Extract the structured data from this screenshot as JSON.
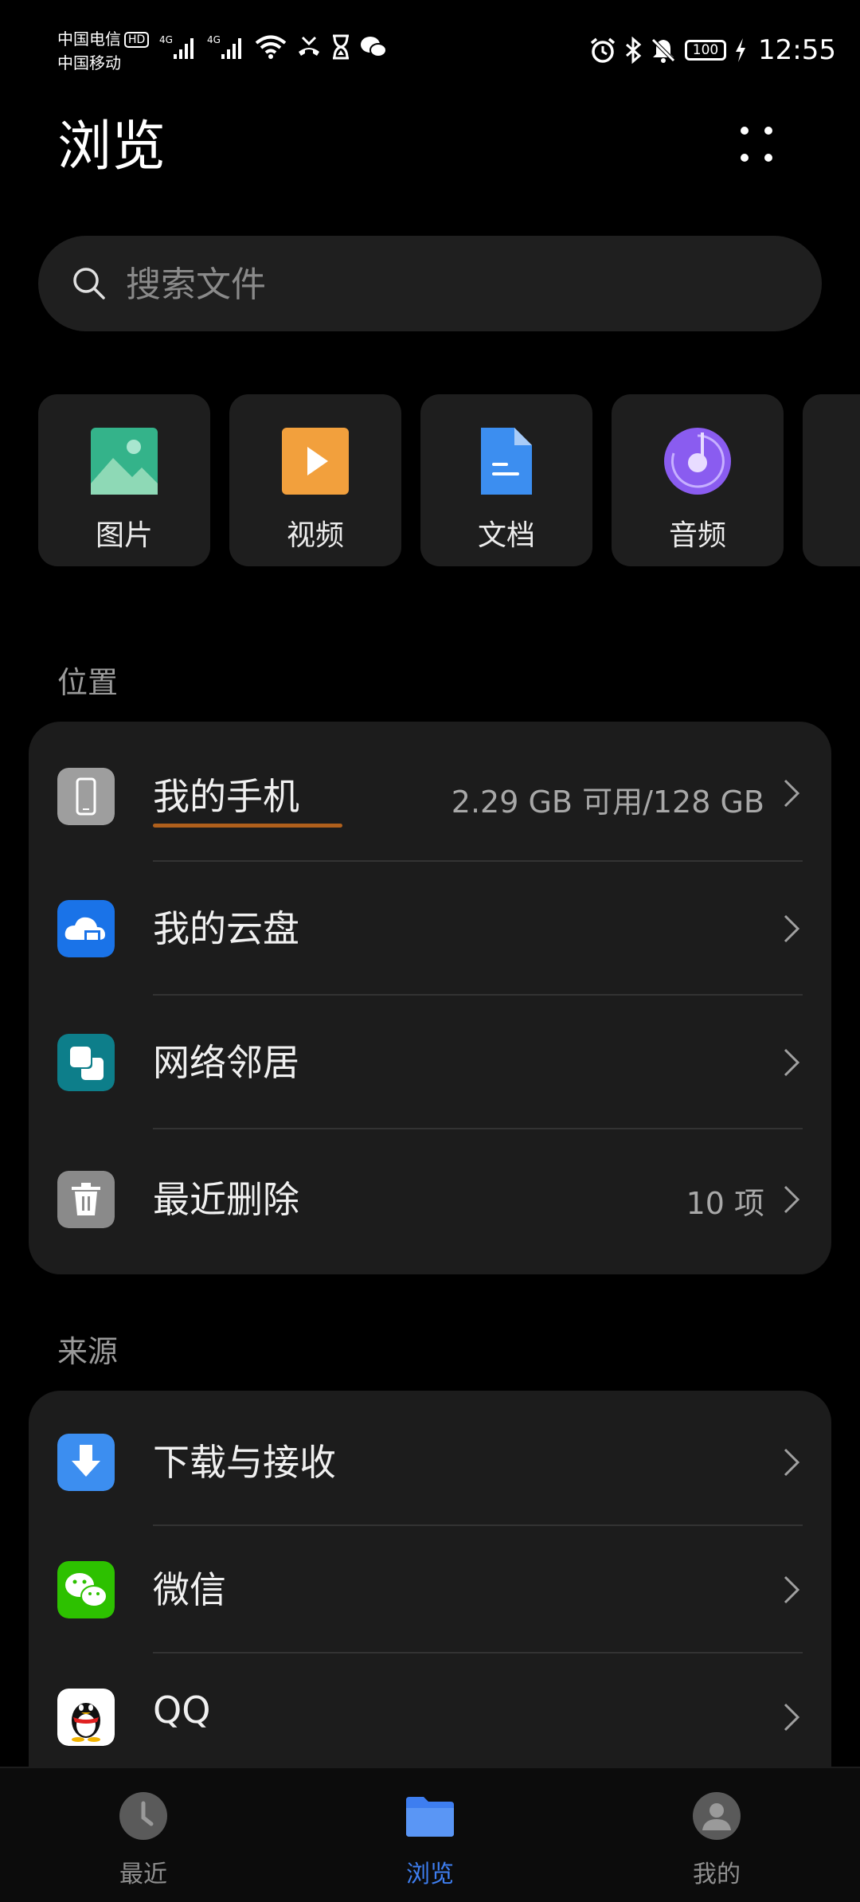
{
  "status_bar": {
    "carrier_1": "中国电信",
    "hd_badge": "HD",
    "carrier_2": "中国移动",
    "signal_1_label": "4G",
    "signal_2_label": "4G",
    "battery_level": "100",
    "time": "12:55"
  },
  "header": {
    "title": "浏览",
    "more_icon": "more-dots-icon"
  },
  "search": {
    "placeholder": "搜索文件"
  },
  "categories": [
    {
      "label": "图片",
      "icon": "image-icon",
      "color": "#34b38a"
    },
    {
      "label": "视频",
      "icon": "video-icon",
      "color": "#f2a03d"
    },
    {
      "label": "文档",
      "icon": "document-icon",
      "color": "#3c8ef0"
    },
    {
      "label": "音频",
      "icon": "audio-icon",
      "color": "#8a5cf0"
    }
  ],
  "locations": {
    "header": "位置",
    "items": [
      {
        "title": "我的手机",
        "detail": "2.29 GB 可用/128 GB",
        "icon": "phone-icon",
        "icon_color": "#9e9e9e",
        "storage_used_fraction": 0.98
      },
      {
        "title": "我的云盘",
        "detail": "",
        "icon": "cloud-icon",
        "icon_color": "#1a73e8"
      },
      {
        "title": "网络邻居",
        "detail": "",
        "icon": "network-icon",
        "icon_color": "#0d7e8a"
      },
      {
        "title": "最近删除",
        "detail": "10 项",
        "icon": "trash-icon",
        "icon_color": "#8a8a8a"
      }
    ]
  },
  "sources": {
    "header": "来源",
    "items": [
      {
        "title": "下载与接收",
        "icon": "download-icon",
        "icon_color": "#3c8ef0"
      },
      {
        "title": "微信",
        "icon": "wechat-icon",
        "icon_color": "#2dc100"
      },
      {
        "title": "QQ",
        "icon": "qq-icon",
        "icon_color": "#ffffff"
      }
    ]
  },
  "bottom_nav": {
    "items": [
      {
        "label": "最近",
        "icon": "clock-icon",
        "active": false
      },
      {
        "label": "浏览",
        "icon": "folder-icon",
        "active": true,
        "color": "#3e7ef0"
      },
      {
        "label": "我的",
        "icon": "profile-icon",
        "active": false
      }
    ]
  }
}
